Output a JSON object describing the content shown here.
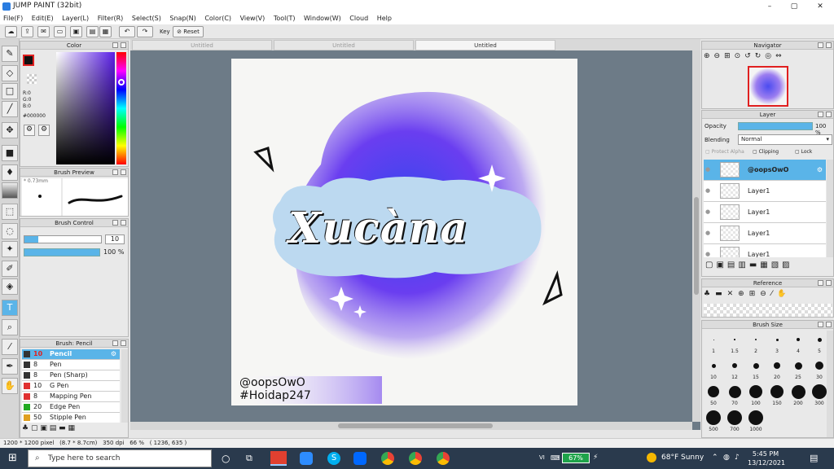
{
  "window": {
    "title": "JUMP PAINT (32bit)",
    "controls": [
      "–",
      "▢",
      "✕"
    ]
  },
  "menu": [
    "File(F)",
    "Edit(E)",
    "Layer(L)",
    "Filter(R)",
    "Select(S)",
    "Snap(N)",
    "Color(C)",
    "View(V)",
    "Tool(T)",
    "Window(W)",
    "Cloud",
    "Help"
  ],
  "toolbar": {
    "key_label": "Key",
    "reset_label": "Reset"
  },
  "doc_tabs": [
    {
      "label": "Untitled",
      "active": false
    },
    {
      "label": "Untitled",
      "active": false
    },
    {
      "label": "Untitled",
      "active": true
    }
  ],
  "color_panel": {
    "title": "Color",
    "r": "R:0",
    "g": "G:0",
    "b": "B:0",
    "hex": "#000000"
  },
  "brush_preview": {
    "title": "Brush Preview",
    "size": "0.73mm"
  },
  "brush_control": {
    "title": "Brush Control",
    "size_value": "10",
    "opacity_value": "100 %"
  },
  "brush_list": {
    "title": "Brush: Pencil",
    "items": [
      {
        "size": "10",
        "name": "Pencil",
        "color": "#333333",
        "selected": true
      },
      {
        "size": "8",
        "name": "Pen",
        "color": "#333333",
        "selected": false
      },
      {
        "size": "8",
        "name": "Pen (Sharp)",
        "color": "#333333",
        "selected": false
      },
      {
        "size": "10",
        "name": "G Pen",
        "color": "#e03030",
        "selected": false
      },
      {
        "size": "8",
        "name": "Mapping Pen",
        "color": "#e03030",
        "selected": false
      },
      {
        "size": "20",
        "name": "Edge Pen",
        "color": "#22aa22",
        "selected": false
      },
      {
        "size": "50",
        "name": "Stipple Pen",
        "color": "#e0a020",
        "selected": false
      }
    ]
  },
  "artwork": {
    "main_text": "Xucàna",
    "credit_1": "@oopsOwO",
    "credit_2": "#Hoidap247"
  },
  "navigator": {
    "title": "Navigator"
  },
  "layer_panel": {
    "title": "Layer",
    "opacity_label": "Opacity",
    "opacity_value": "100 %",
    "blending_label": "Blending",
    "blending_value": "Normal",
    "protect_alpha": "Protect Alpha",
    "clipping": "Clipping",
    "lock": "Lock",
    "layers": [
      {
        "name": "@oopsOwO",
        "selected": true
      },
      {
        "name": "Layer1",
        "selected": false
      },
      {
        "name": "Layer1",
        "selected": false
      },
      {
        "name": "Layer1",
        "selected": false
      },
      {
        "name": "Layer1",
        "selected": false
      }
    ]
  },
  "reference": {
    "title": "Reference"
  },
  "brush_size": {
    "title": "Brush Size",
    "labels": [
      "1",
      "1.5",
      "2",
      "3",
      "4",
      "5",
      "10",
      "12",
      "15",
      "20",
      "25",
      "30",
      "50",
      "70",
      "100",
      "150",
      "200",
      "300",
      "500",
      "700",
      "1000"
    ]
  },
  "status": {
    "pixels": "1200 * 1200 pixel",
    "cm": "(8.7 * 8.7cm)",
    "dpi": "350 dpi",
    "zoom": "66 %",
    "coords": "( 1236, 635 )"
  },
  "taskbar": {
    "search_placeholder": "Type here to search",
    "lang": "VI",
    "battery": "67%",
    "weather": "68°F  Sunny",
    "time": "5:45 PM",
    "date": "13/12/2021"
  }
}
